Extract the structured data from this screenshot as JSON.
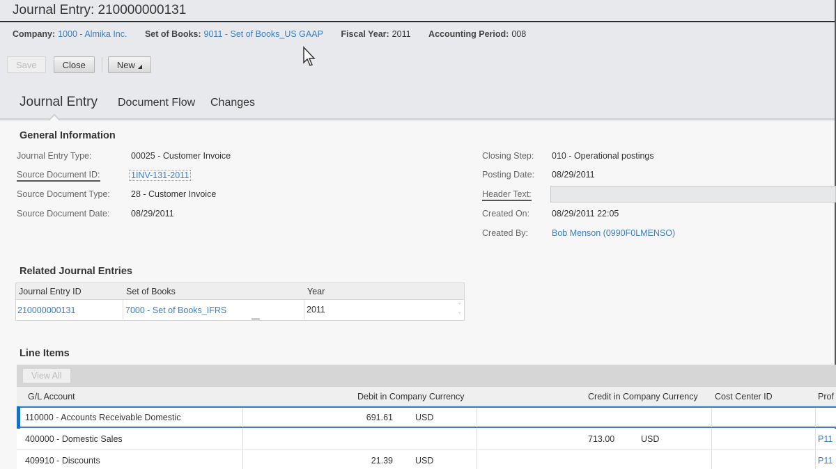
{
  "window": {
    "title": "Journal Entry: 210000000131"
  },
  "info_bar": {
    "company_label": "Company:",
    "company_value": "1000 - Almika Inc.",
    "set_of_books_label": "Set of Books:",
    "set_of_books_value": "9011 - Set of Books_US GAAP",
    "fiscal_year_label": "Fiscal Year:",
    "fiscal_year_value": "2011",
    "accounting_period_label": "Accounting Period:",
    "accounting_period_value": "008"
  },
  "toolbar": {
    "save_label": "Save",
    "close_label": "Close",
    "new_label": "New"
  },
  "tabs": [
    {
      "label": "Journal Entry",
      "active": true
    },
    {
      "label": "Document Flow",
      "active": false
    },
    {
      "label": "Changes",
      "active": false
    }
  ],
  "general_info": {
    "title": "General Information",
    "left": [
      {
        "label": "Journal Entry Type:",
        "value": "00025 - Customer Invoice"
      },
      {
        "label": "Source Document ID:",
        "value": "1INV-131-2011"
      },
      {
        "label": "Source Document Type:",
        "value": "28 - Customer Invoice"
      },
      {
        "label": "Source Document Date:",
        "value": "08/29/2011"
      }
    ],
    "right": [
      {
        "label": "Closing Step:",
        "value": "010 - Operational postings"
      },
      {
        "label": "Posting Date:",
        "value": "08/29/2011"
      },
      {
        "label": "Header Text:",
        "value": ""
      },
      {
        "label": "Created On:",
        "value": "08/29/2011 22:05"
      },
      {
        "label": "Created By:",
        "value": "Bob Menson (0990F0LMENSO)"
      }
    ]
  },
  "related": {
    "title": "Related Journal Entries",
    "columns": [
      "Journal Entry ID",
      "Set of Books",
      "Year"
    ],
    "rows": [
      {
        "id": "210000000131",
        "set_of_books": "7000 - Set of Books_IFRS",
        "year": "2011"
      }
    ]
  },
  "line_items": {
    "title": "Line Items",
    "view_all_label": "View All",
    "columns": [
      "G/L Account",
      "Debit in Company Currency",
      "Credit in Company Currency",
      "Cost Center ID",
      "Prof"
    ],
    "rows": [
      {
        "account": "110000 - Accounts Receivable Domestic",
        "debit": "691.61",
        "debit_cur": "USD",
        "credit": "",
        "credit_cur": "",
        "cost_center": "",
        "profit": ""
      },
      {
        "account": "400000 - Domestic Sales",
        "debit": "",
        "debit_cur": "",
        "credit": "713.00",
        "credit_cur": "USD",
        "cost_center": "",
        "profit": "P11"
      },
      {
        "account": "409910 - Discounts",
        "debit": "21.39",
        "debit_cur": "USD",
        "credit": "",
        "credit_cur": "",
        "cost_center": "",
        "profit": "P11"
      }
    ]
  },
  "colors": {
    "link": "#3c7ec0",
    "selection": "#1672c0"
  }
}
